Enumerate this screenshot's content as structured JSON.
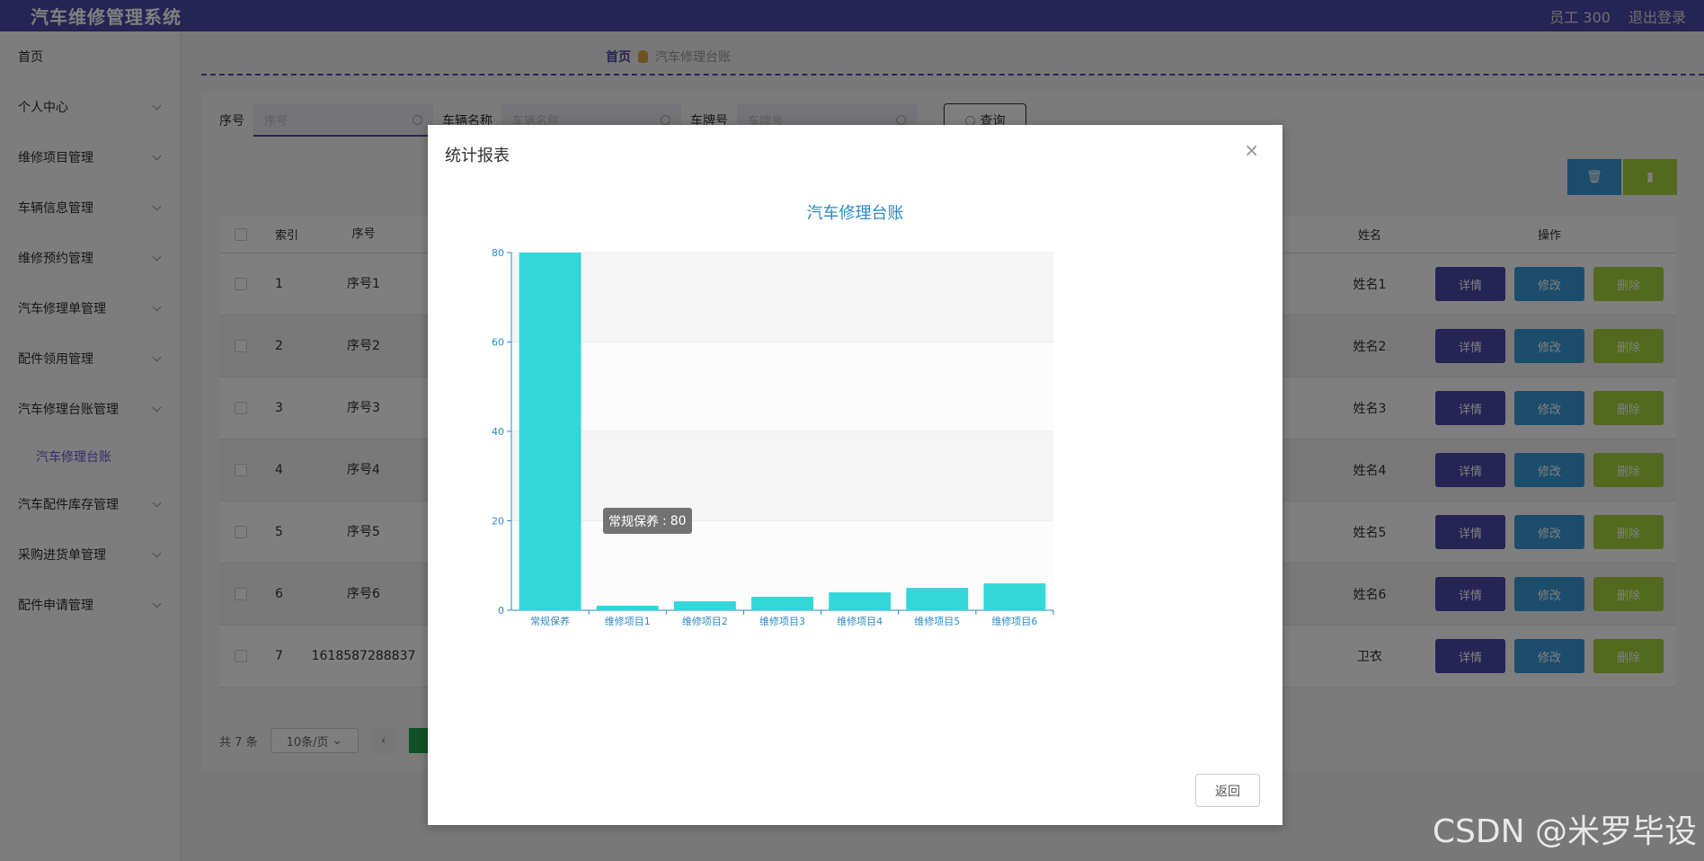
{
  "header": {
    "title": "汽车维修管理系统",
    "user": "员工 300",
    "logout": "退出登录"
  },
  "sidebar": {
    "items": [
      {
        "label": "首页",
        "chevron": false
      },
      {
        "label": "个人中心",
        "chevron": true
      },
      {
        "label": "维修项目管理",
        "chevron": true
      },
      {
        "label": "车辆信息管理",
        "chevron": true
      },
      {
        "label": "维修预约管理",
        "chevron": true
      },
      {
        "label": "汽车修理单管理",
        "chevron": true
      },
      {
        "label": "配件领用管理",
        "chevron": true
      },
      {
        "label": "汽车修理台账管理",
        "chevron": true
      }
    ],
    "active_sub": "汽车修理台账",
    "items_after": [
      {
        "label": "汽车配件库存管理",
        "chevron": true
      },
      {
        "label": "采购进货单管理",
        "chevron": true
      },
      {
        "label": "配件申请管理",
        "chevron": true
      }
    ]
  },
  "breadcrumb": {
    "home": "首页",
    "current": "汽车修理台账"
  },
  "search": {
    "f1_label": "序号",
    "f1_placeholder": "序号",
    "f2_label": "车辆名称",
    "f2_placeholder": "车辆名称",
    "f3_label": "车牌号",
    "f3_placeholder": "车牌号",
    "button": "查询"
  },
  "toolbar": {
    "delete_icon": "trash-icon",
    "stats_icon": "bar-chart-icon",
    "delete_color": "#3a9bd8",
    "stats_color": "#a6d23d"
  },
  "table": {
    "headers": {
      "index": "索引",
      "seq": "序号",
      "name": "姓名",
      "ops": "操作"
    },
    "rows": [
      {
        "index": "1",
        "seq": "序号1",
        "name": "姓名1"
      },
      {
        "index": "2",
        "seq": "序号2",
        "name": "姓名2"
      },
      {
        "index": "3",
        "seq": "序号3",
        "name": "姓名3"
      },
      {
        "index": "4",
        "seq": "序号4",
        "name": "姓名4"
      },
      {
        "index": "5",
        "seq": "序号5",
        "name": "姓名5"
      },
      {
        "index": "6",
        "seq": "序号6",
        "name": "姓名6"
      },
      {
        "index": "7",
        "seq": "1618587288837",
        "name": "卫衣"
      }
    ],
    "ops": {
      "detail": "详情",
      "edit": "修改",
      "delete": "删除"
    }
  },
  "pager": {
    "total": "共 7 条",
    "size": "10条/页"
  },
  "dialog": {
    "title": "统计报表",
    "close": "×",
    "back": "返回",
    "tooltip_label": "常规保养",
    "tooltip_value": "80"
  },
  "chart_data": {
    "type": "bar",
    "title": "汽车修理台账",
    "categories": [
      "常规保养",
      "维修项目1",
      "维修项目2",
      "维修项目3",
      "维修项目4",
      "维修项目5",
      "维修项目6"
    ],
    "values": [
      80,
      1,
      2,
      3,
      4,
      5,
      6
    ],
    "ylim": [
      0,
      80
    ],
    "yticks": [
      0,
      20,
      40,
      60,
      80
    ],
    "grid": true,
    "bar_color": "#33d6d9",
    "axis_color": "#2d8ac4"
  },
  "watermark": "CSDN @米罗毕设"
}
